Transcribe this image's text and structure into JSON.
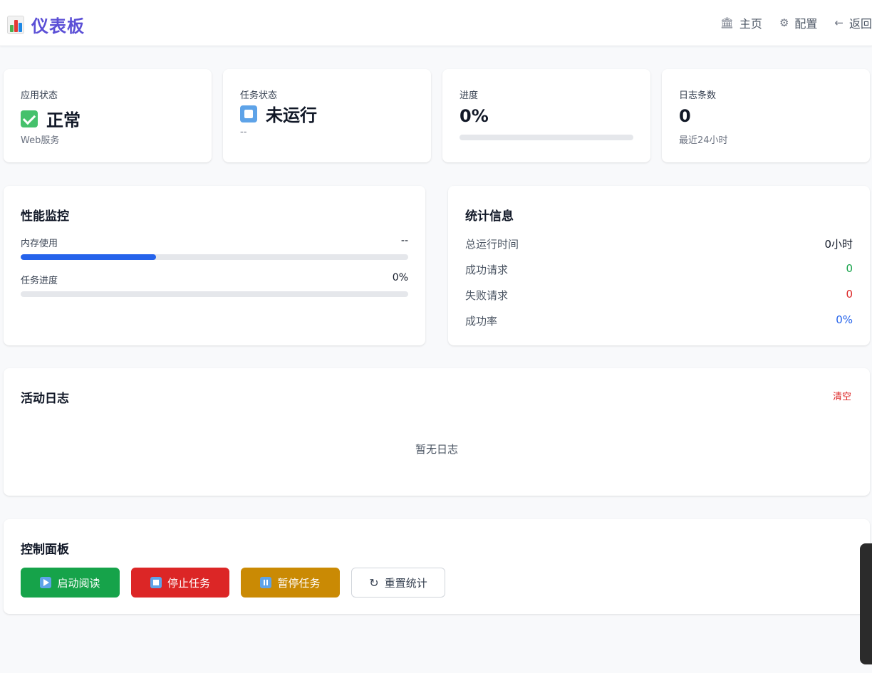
{
  "header": {
    "title": "仪表板",
    "nav": [
      {
        "icon": "bank-icon",
        "glyph": "🏛",
        "label": "主页"
      },
      {
        "icon": "gear-icon",
        "glyph": "⚙",
        "label": "配置"
      },
      {
        "icon": "arrow-left-icon",
        "glyph": "←",
        "label": "返回"
      }
    ]
  },
  "stats": {
    "app_status": {
      "label": "应用状态",
      "value": "正常",
      "sub": "Web服务"
    },
    "task_status": {
      "label": "任务状态",
      "value": "未运行",
      "sub": "--"
    },
    "progress": {
      "label": "进度",
      "value": "0%",
      "fraction": 0
    },
    "log_count": {
      "label": "日志条数",
      "value": "0",
      "sub": "最近24小时"
    }
  },
  "performance": {
    "title": "性能监控",
    "memory": {
      "label": "内存使用",
      "value": "--",
      "fraction": 0.35
    },
    "task_progress": {
      "label": "任务进度",
      "value": "0%",
      "fraction": 0
    }
  },
  "statistics": {
    "title": "统计信息",
    "rows": [
      {
        "label": "总运行时间",
        "value": "0小时",
        "color": "#111827"
      },
      {
        "label": "成功请求",
        "value": "0",
        "color": "#16a34a"
      },
      {
        "label": "失败请求",
        "value": "0",
        "color": "#dc2626"
      },
      {
        "label": "成功率",
        "value": "0%",
        "color": "#2563eb"
      }
    ]
  },
  "activity_log": {
    "title": "活动日志",
    "clear_label": "清空",
    "empty_text": "暂无日志"
  },
  "controls": {
    "title": "控制面板",
    "buttons": [
      {
        "label": "启动阅读",
        "color": "#16a34a"
      },
      {
        "label": "停止任务",
        "color": "#dc2626"
      },
      {
        "label": "暂停任务",
        "color": "#ca8a04"
      },
      {
        "label": "重置统计",
        "glyph": "↻"
      }
    ]
  },
  "colors": {
    "brand": "#5b4fd6",
    "accent": "#2563eb"
  }
}
